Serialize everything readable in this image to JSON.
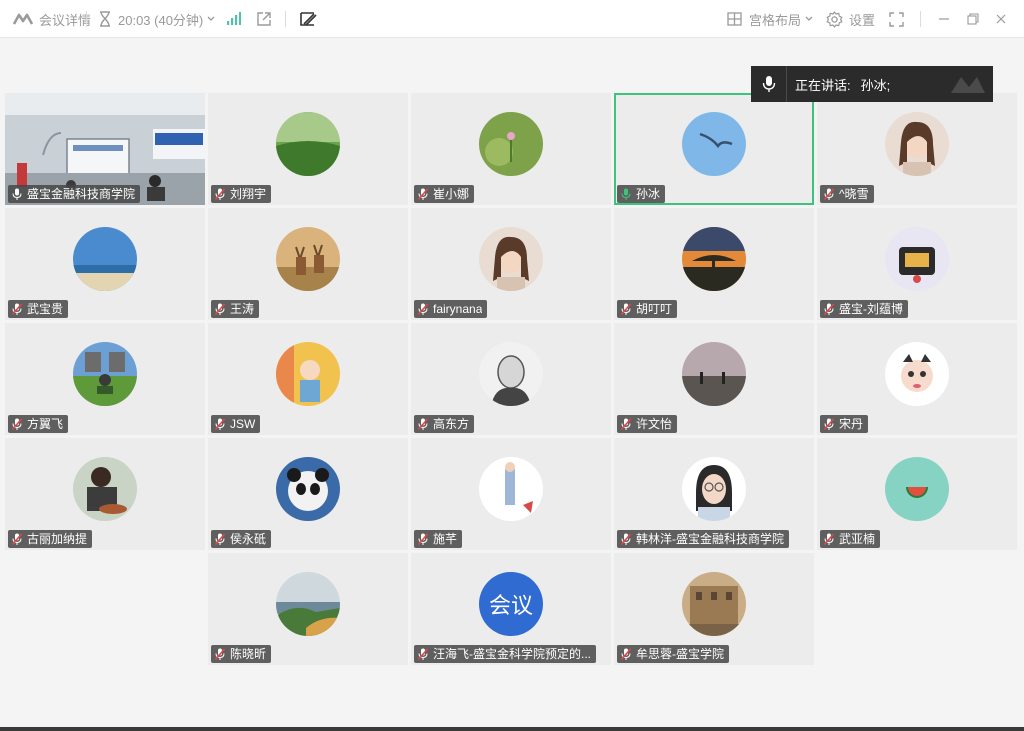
{
  "toolbar": {
    "meeting_info": "会议详情",
    "time": "20:03 (40分钟)",
    "layout": "宫格布局",
    "settings": "设置"
  },
  "speaking": {
    "label": "正在讲话:",
    "name": "孙冰;"
  },
  "colors": {
    "accent": "#3cc47c",
    "muted_mic": "#e04848",
    "tag_bg": "#464646"
  },
  "participants": [
    {
      "name": "盛宝金融科技商学院",
      "mic": "on",
      "avatar": "classroom-video"
    },
    {
      "name": "刘翔宇",
      "mic": "muted",
      "avatar": "grass-field"
    },
    {
      "name": "崔小娜",
      "mic": "muted",
      "avatar": "flower-bokeh"
    },
    {
      "name": "孙冰",
      "mic": "speaking",
      "avatar": "seagull-sky",
      "active": true
    },
    {
      "name": "^晓雪",
      "mic": "muted",
      "avatar": "woman-portrait"
    },
    {
      "name": "武宝贵",
      "mic": "muted",
      "avatar": "beach"
    },
    {
      "name": "王涛",
      "mic": "muted",
      "avatar": "deer"
    },
    {
      "name": "fairynana",
      "mic": "muted",
      "avatar": "woman-portrait"
    },
    {
      "name": "胡叮叮",
      "mic": "muted",
      "avatar": "sunset-tree"
    },
    {
      "name": "盛宝-刘蕴博",
      "mic": "muted",
      "avatar": "toy-radio"
    },
    {
      "name": "方翼飞",
      "mic": "muted",
      "avatar": "person-lawn"
    },
    {
      "name": "JSW",
      "mic": "muted",
      "avatar": "child"
    },
    {
      "name": "高东方",
      "mic": "muted",
      "avatar": "engraving-portrait"
    },
    {
      "name": "许文怡",
      "mic": "muted",
      "avatar": "dusk-people"
    },
    {
      "name": "宋丹",
      "mic": "muted",
      "avatar": "cartoon-girl"
    },
    {
      "name": "古丽加纳提",
      "mic": "muted",
      "avatar": "person-eating"
    },
    {
      "name": "侯永砥",
      "mic": "muted",
      "avatar": "panda"
    },
    {
      "name": "施芊",
      "mic": "muted",
      "avatar": "illustration"
    },
    {
      "name": "韩林洋-盛宝金融科技商学院",
      "mic": "muted",
      "avatar": "glasses-woman"
    },
    {
      "name": "武亚楠",
      "mic": "muted",
      "avatar": "watermelon-icon"
    },
    {
      "name": "陈晓昕",
      "mic": "muted",
      "avatar": "coast-cliff"
    },
    {
      "name": "汪海飞-盛宝金科学院预定的...",
      "mic": "muted",
      "avatar": "text-avatar",
      "avatar_text": "会议"
    },
    {
      "name": "牟思蓉-盛宝学院",
      "mic": "muted",
      "avatar": "palace"
    }
  ]
}
